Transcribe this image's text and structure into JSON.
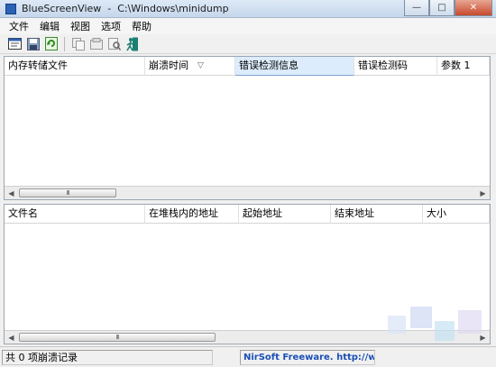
{
  "window": {
    "title": "BlueScreenView  -  C:\\Windows\\minidump",
    "minimize_icon": "minimize-icon",
    "maximize_icon": "maximize-icon",
    "close_icon": "close-icon",
    "min_glyph": "—",
    "max_glyph": "□",
    "close_glyph": "✕"
  },
  "menu": [
    "文件",
    "编辑",
    "视图",
    "选项",
    "帮助"
  ],
  "toolbar": {
    "icons": [
      "properties-icon",
      "save-icon",
      "refresh-icon",
      "copy-icon",
      "html-report-icon",
      "find-icon",
      "exit-icon"
    ]
  },
  "crash_list": {
    "columns": [
      "内存转储文件",
      "崩溃时间",
      "错误检测信息",
      "错误检测码",
      "参数 1"
    ],
    "sorted_column": "崩溃时间",
    "sort_glyph": "▽",
    "active_column": "错误检测信息",
    "rows": []
  },
  "driver_list": {
    "columns": [
      "文件名",
      "在堆栈内的地址",
      "起始地址",
      "结束地址",
      "大小"
    ],
    "rows": []
  },
  "scrollbar": {
    "left_glyph": "◀",
    "right_glyph": "▶",
    "grip": "III"
  },
  "status": {
    "records": "共 0 项崩溃记录",
    "link": "NirSoft Freeware.  http://ww"
  },
  "colors": {
    "link": "#1a4fb5",
    "active_header": "#dcecfc",
    "title_gradient_top": "#dde9f6"
  }
}
